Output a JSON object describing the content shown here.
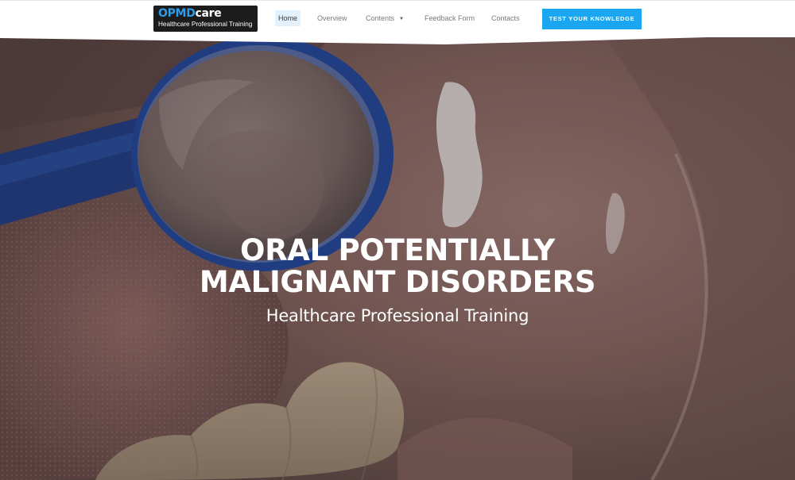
{
  "header": {
    "logo": {
      "brand_part1": "OPMD",
      "brand_part2": "care",
      "tagline": "Healthcare Professional Training"
    },
    "nav": [
      {
        "label": "Home",
        "active": true
      },
      {
        "label": "Overview",
        "active": false
      },
      {
        "label": "Contents",
        "active": false,
        "has_dropdown": true
      },
      {
        "label": "Feedback Form",
        "active": false
      },
      {
        "label": "Contacts",
        "active": false
      }
    ],
    "cta_label": "TEST YOUR KNOWLEDGE",
    "colors": {
      "accent": "#1aa6f0",
      "brand_blue": "#2f9be8",
      "logo_bg": "#1c1c1c"
    }
  },
  "hero": {
    "title_line1": "ORAL POTENTIALLY",
    "title_line2": "MALIGNANT DISORDERS",
    "subtitle": "Healthcare Professional Training",
    "background": "intraoral photograph showing a dental mirror, tongue, lower teeth and a white lesion on the buccal mucosa"
  },
  "icons": {
    "dropdown": "chevron-down-icon"
  }
}
